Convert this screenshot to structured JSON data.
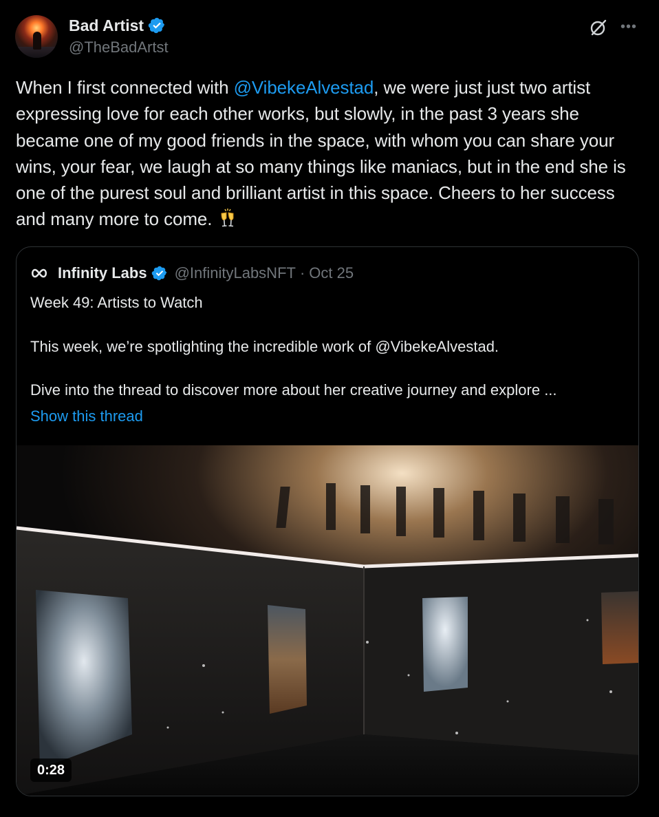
{
  "author": {
    "name": "Bad Artist",
    "handle": "@TheBadArtst",
    "verified": true
  },
  "post": {
    "text_before": "When I first connected with ",
    "mention": "@VibekeAlvestad",
    "text_after": ", we were just just two artist expressing love for each other works, but slowly, in the past 3 years she became one of my good friends in the space, with whom you can share your wins, your fear, we laugh at so many things like maniacs, but in the end she is one of the purest soul and brilliant artist in this space. Cheers to her success and many more to come. ",
    "emoji": "clinking-glasses-icon"
  },
  "header_icons": [
    "grok-icon",
    "more-options-icon"
  ],
  "quote": {
    "name": "Infinity Labs",
    "handle": "@InfinityLabsNFT",
    "separator": "·",
    "date": "Oct 25",
    "verified": true,
    "title": "Week 49: Artists to Watch",
    "line2": "This week, we’re spotlighting the incredible work of @VibekeAlvestad.",
    "line3": "Dive into the thread to discover more about her creative journey and explore ...",
    "show_thread": "Show this thread",
    "video": {
      "duration": "0:28"
    }
  },
  "colors": {
    "background": "#000000",
    "text": "#e7e9ea",
    "secondary": "#71767b",
    "accent": "#1d9bf0",
    "border": "#2f3336"
  }
}
